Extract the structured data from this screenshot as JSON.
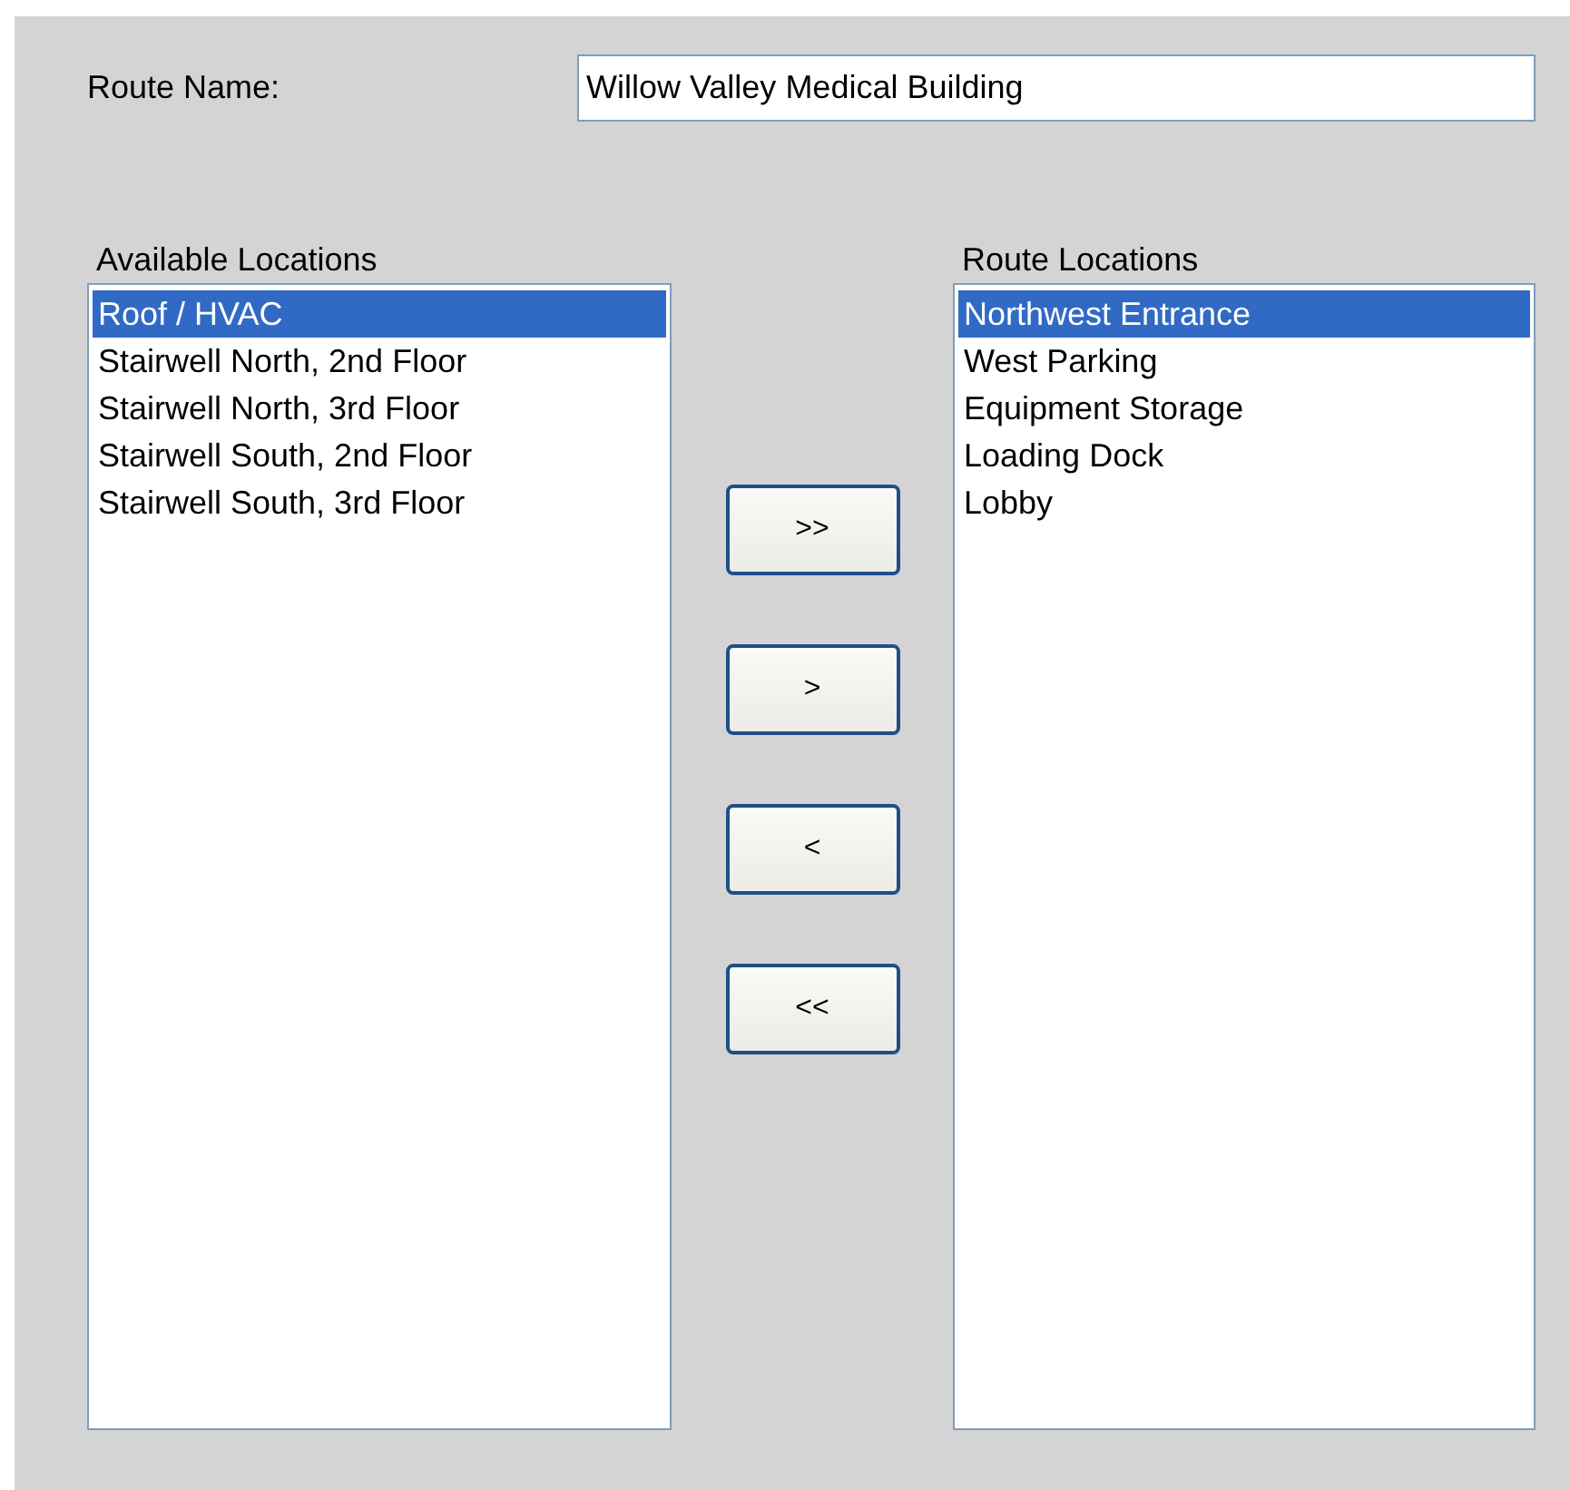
{
  "route_name": {
    "label": "Route Name:",
    "value": "Willow Valley Medical Building"
  },
  "available_locations": {
    "title": "Available Locations",
    "items": [
      {
        "label": "Roof / HVAC",
        "selected": true
      },
      {
        "label": "Stairwell North, 2nd Floor",
        "selected": false
      },
      {
        "label": "Stairwell North, 3rd Floor",
        "selected": false
      },
      {
        "label": "Stairwell South, 2nd Floor",
        "selected": false
      },
      {
        "label": "Stairwell South, 3rd Floor",
        "selected": false
      }
    ]
  },
  "buttons": [
    {
      "label": ">>"
    },
    {
      "label": ">"
    },
    {
      "label": "<"
    },
    {
      "label": "<<"
    }
  ],
  "route_locations": {
    "title": "Route Locations",
    "items": [
      {
        "label": "Northwest Entrance",
        "selected": true
      },
      {
        "label": "West Parking",
        "selected": false
      },
      {
        "label": "Equipment Storage",
        "selected": false
      },
      {
        "label": "Loading Dock",
        "selected": false
      },
      {
        "label": "Lobby",
        "selected": false
      }
    ]
  }
}
